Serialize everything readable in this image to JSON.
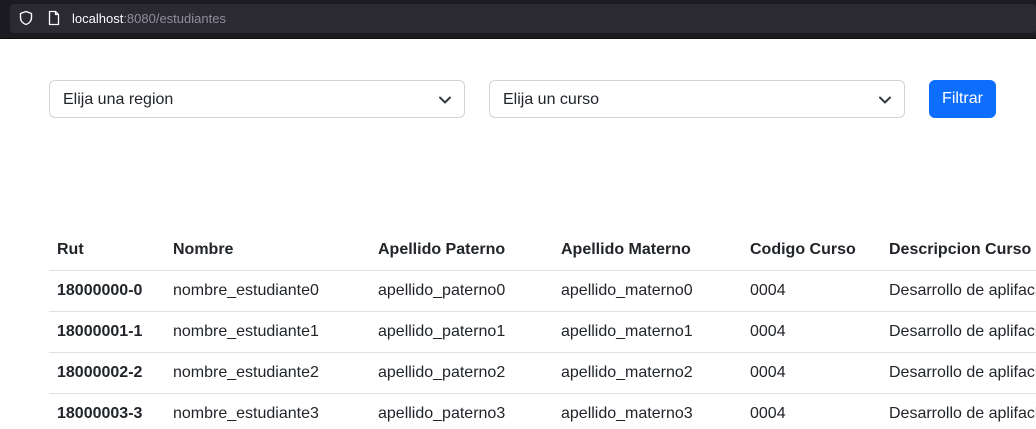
{
  "browser": {
    "url_host": "localhost",
    "url_rest": ":8080/estudiantes"
  },
  "filters": {
    "region_placeholder": "Elija una region",
    "curso_placeholder": "Elija un curso",
    "submit_label": "Filtrar"
  },
  "table": {
    "headers": [
      "Rut",
      "Nombre",
      "Apellido Paterno",
      "Apellido Materno",
      "Codigo Curso",
      "Descripcion Curso"
    ],
    "rows": [
      [
        "18000000-0",
        "nombre_estudiante0",
        "apellido_paterno0",
        "apellido_materno0",
        "0004",
        "Desarrollo de aplifaci"
      ],
      [
        "18000001-1",
        "nombre_estudiante1",
        "apellido_paterno1",
        "apellido_materno1",
        "0004",
        "Desarrollo de aplifaci"
      ],
      [
        "18000002-2",
        "nombre_estudiante2",
        "apellido_paterno2",
        "apellido_materno2",
        "0004",
        "Desarrollo de aplifaci"
      ],
      [
        "18000003-3",
        "nombre_estudiante3",
        "apellido_paterno3",
        "apellido_materno3",
        "0004",
        "Desarrollo de aplifaci"
      ]
    ]
  },
  "colors": {
    "primary": "#0d6efd",
    "border": "#ced4da",
    "table_border": "#dee2e6",
    "text": "#212529"
  },
  "icons": {
    "url_bar": [
      "shield-icon",
      "page-icon"
    ],
    "select": "chevron-down-icon"
  }
}
